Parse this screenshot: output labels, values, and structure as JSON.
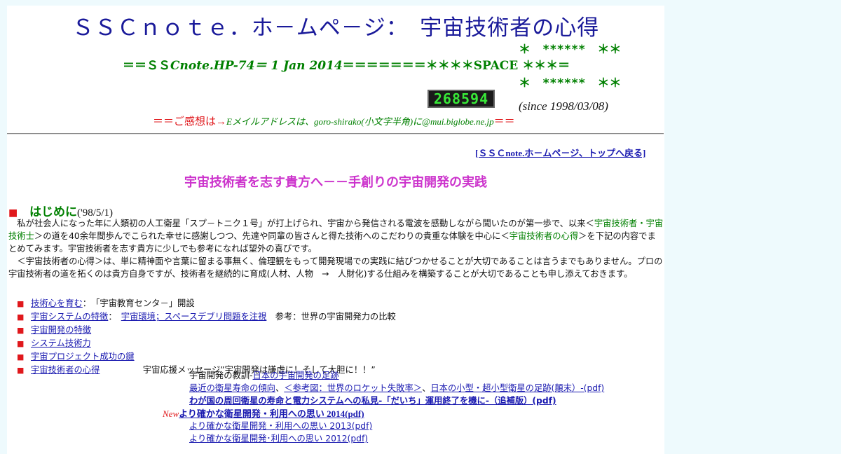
{
  "title": "ＳＳＣｎｏｔｅ．ホ－ムペ－ジ：　宇宙技術者の心得",
  "stars_top": "＊　******　＊＊",
  "stars_bottom": "＊　******　＊＊",
  "subtitle": {
    "prefix": "＝＝ＳＳ",
    "italic_part": "Cnote.HP-74＝ 1 Jan 2014",
    "suffix": "＝＝＝＝＝＝＝＊＊＊＊SPACE ＊＊＊＝"
  },
  "counter": "268594",
  "since": "(since 1998/03/08)",
  "feedback": {
    "red_prefix": "＝＝ご感想は→",
    "green_text": "Eメイルアドレスは、goro-shirako(小文字半角)に@mui.biglobe.ne.jp",
    "red_suffix": "＝＝"
  },
  "top_link": "[ＳＳＣnote.ホ－ムペ－ジ、トップへ戻る]",
  "heading": "宇宙技術者を志す貴方へ－－手創りの宇宙開発の実践",
  "intro": {
    "bullet": "■",
    "title": "はじめに",
    "date": "('98/5/1)"
  },
  "para1": {
    "a": "　私が社会人になった年に人類初の人工衛星「スプ－トニク１号」が打上げられ、宇宙から発信される電波を感動しながら聞いたのが第一歩で、以来＜",
    "b": "宇宙技術者・宇宙技術士",
    "c": "＞の道を40余年間歩んでこられた幸せに感謝しつつ、先達や同輩の皆さんと得た技術へのこだわりの貴重な体験を中心に＜",
    "d": "宇宙技術者の心得",
    "e": "＞を下記の内容でまとめてみます。宇宙技術者を志す貴方に少しでも参考になれば望外の喜びです。"
  },
  "para2": "　＜宇宙技術者の心得＞は、単に精神面や言葉に留まる事無く、倫理観をもって開発現場での実践に結びつかせることが大切であることは言うまでもありません。プロの宇宙技術者の道を拓くのは貴方自身ですが、技術者を継続的に育成(人材、人物　→　人財化)する仕組みを構築することが大切であることも申し添えておきます。",
  "list": [
    {
      "link": "技術心を育む",
      "after": "：　「宇宙教育センタ－」開設"
    },
    {
      "link": "宇宙システムの特徴",
      "after": "：　",
      "link2": "宇宙環境；スペースデブリ問題を注視",
      "after2": "　参考：世界の宇宙開発力の比較"
    },
    {
      "link": "宇宙開発の特徴",
      "after": ""
    },
    {
      "link": "システム技術力",
      "after": ""
    },
    {
      "link": "宇宙プロジェクト成功の鍵",
      "after": ""
    },
    {
      "link": "宇宙技術者の心得",
      "after": "　　　　　宇宙応援メッセージ”宇宙開発は謙虚に！そして大胆に！！”"
    }
  ],
  "sub": {
    "s1_text": "宇宙開発の教訓-",
    "s1_link": "日本の宇宙開発の足跡",
    "s2_link1": "最近の衛星寿命の傾向",
    "s2_sep1": "、",
    "s2_link2": "＜参考図：世界のロケット失敗率＞",
    "s2_sep2": "、",
    "s2_link3": "日本の小型・超小型衛星の足跡(顛末）-(pdf)",
    "s3_link": "わが国の周回衛星の寿命と電力システムへの私見-「だいち」運用終了を機に-（追補版）(pdf)",
    "new_tag": "New",
    "new_link": "より確かな衛星開発・利用への思い 2014(pdf)",
    "s5_link": "より確かな衛星開発・利用への思い 2013(pdf)",
    "s6_link": "より確かな衛星開発･利用への思い 2012(pdf)"
  },
  "colors": {
    "title": "#1a1a9a",
    "green": "#008000",
    "red": "#e0181c",
    "link": "#1a1ab0",
    "heading": "#cc33cc",
    "background": "#eefafd"
  }
}
